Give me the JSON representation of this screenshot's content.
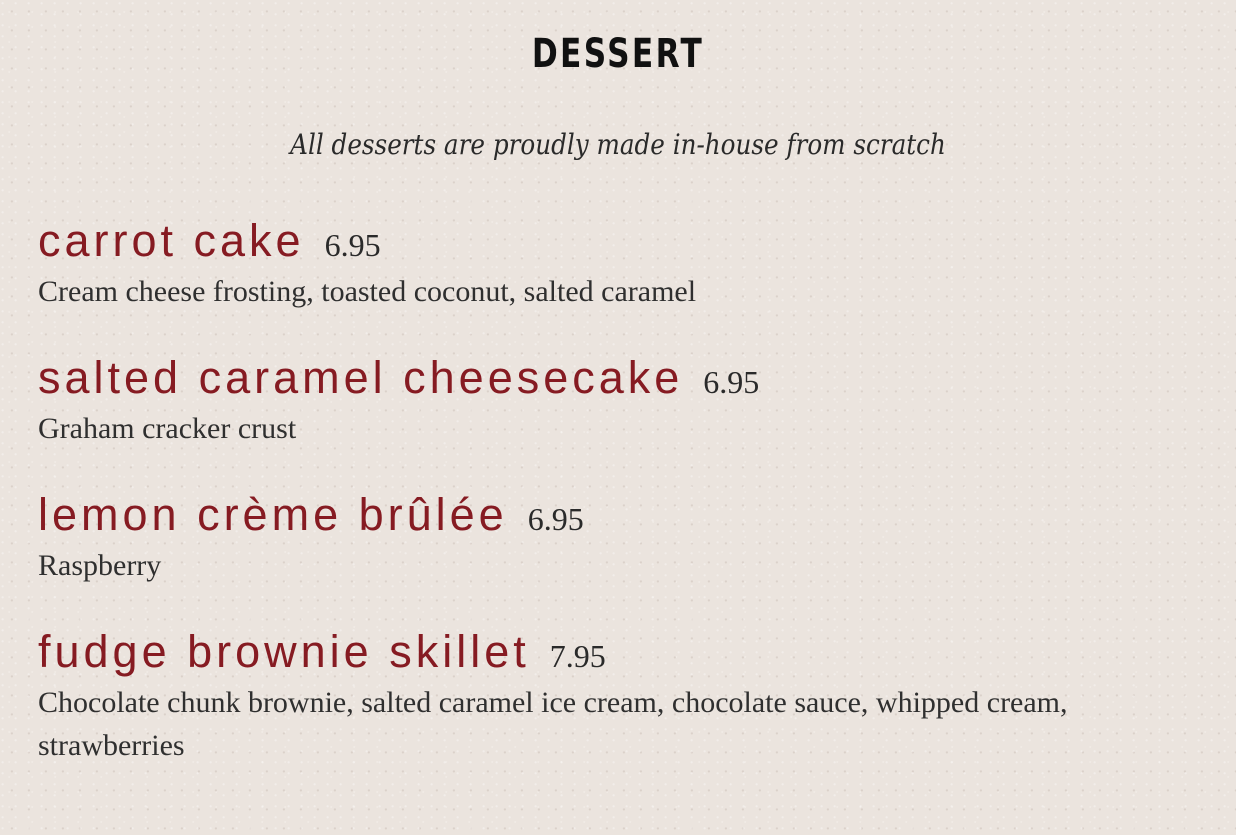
{
  "page": {
    "title": "DESSERT",
    "tagline": "All desserts are proudly made in-house from scratch"
  },
  "colors": {
    "background": "#ebe4de",
    "item_name": "#861b22",
    "text": "#2a2a2a"
  },
  "items": [
    {
      "name": "carrot cake",
      "price": "6.95",
      "description": "Cream cheese frosting, toasted coconut, salted caramel"
    },
    {
      "name": "salted caramel cheesecake",
      "price": "6.95",
      "description": "Graham cracker crust"
    },
    {
      "name": "lemon crème brûlée",
      "price": "6.95",
      "description": "Raspberry"
    },
    {
      "name": "fudge brownie skillet",
      "price": "7.95",
      "description": "Chocolate chunk brownie, salted caramel ice cream, chocolate sauce, whipped cream, strawberries"
    }
  ]
}
